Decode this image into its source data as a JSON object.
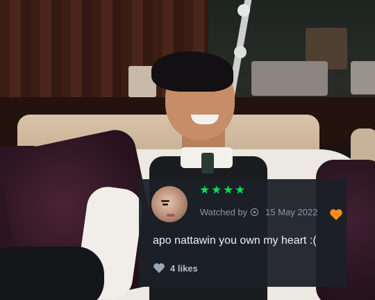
{
  "review": {
    "stars": [
      "★",
      "★",
      "★",
      "★"
    ],
    "watched_label": "Watched by",
    "date": "15 May 2022",
    "text": "apo nattawin you own my heart :(",
    "likes": "4 likes"
  },
  "colors": {
    "star_green": "#00e054",
    "liked_orange": "#ff8c1a",
    "card_bg": "#1c2026"
  },
  "icons": {
    "rating": "star-icon",
    "watched": "eye-icon",
    "liked": "heart-icon",
    "likes": "heart-icon"
  }
}
